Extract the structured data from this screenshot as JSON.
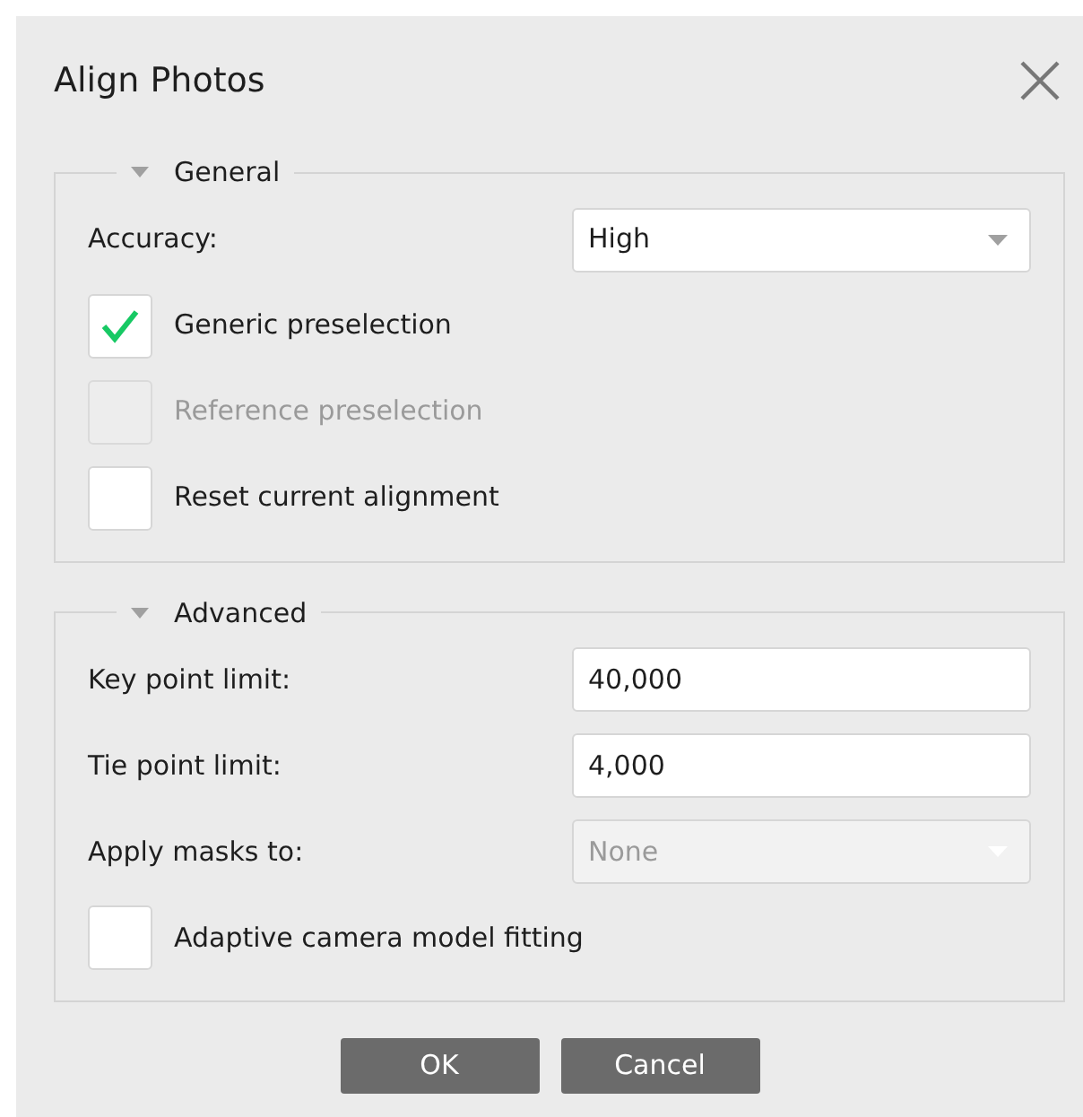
{
  "dialog": {
    "title": "Align Photos"
  },
  "groups": [
    {
      "title": "General",
      "expanded": true,
      "rows": [
        {
          "kind": "dropdown",
          "label": "Accuracy:",
          "value": "High",
          "disabled": false
        },
        {
          "kind": "checkbox",
          "label": "Generic preselection",
          "checked": true,
          "disabled": false
        },
        {
          "kind": "checkbox",
          "label": "Reference preselection",
          "checked": false,
          "disabled": true
        },
        {
          "kind": "checkbox",
          "label": "Reset current alignment",
          "checked": false,
          "disabled": false
        }
      ]
    },
    {
      "title": "Advanced",
      "expanded": true,
      "rows": [
        {
          "kind": "field",
          "label": "Key point limit:",
          "value": "40,000"
        },
        {
          "kind": "field",
          "label": "Tie point limit:",
          "value": "4,000"
        },
        {
          "kind": "dropdown",
          "label": "Apply masks to:",
          "value": "None",
          "disabled": true
        },
        {
          "kind": "checkbox",
          "label": "Adaptive camera model fitting",
          "checked": false,
          "disabled": false
        }
      ]
    }
  ],
  "buttons": [
    "OK",
    "Cancel"
  ]
}
